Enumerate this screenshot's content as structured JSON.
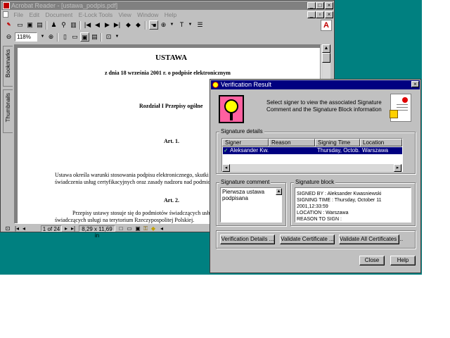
{
  "acrobat": {
    "title": "Acrobat Reader - [ustawa_podpis.pdf]",
    "menu": [
      "File",
      "Edit",
      "Document",
      "E-Lock Tools",
      "View",
      "Window",
      "Help"
    ],
    "zoom": "118%",
    "side_tabs": {
      "bookmarks": "Bookmarks",
      "thumbnails": "Thumbnails"
    },
    "status": {
      "page": "1 of 24",
      "size": "8,29 x 11,69 in"
    }
  },
  "document": {
    "heading": "USTAWA",
    "subheading": "z dnia 18 września 2001 r.  o podpisie elektronicznym",
    "chapter": "Rozdział I  Przepisy ogólne",
    "art1": "Art. 1.",
    "para1_line1": "Ustawa określa warunki stosowania podpisu elektronicznego, skutki",
    "para1_line2": "świadczenia usług certyfikacyjnych oraz zasady nadzoru nad podmio",
    "art2": "Art. 2.",
    "para2_line1": "Przepisy ustawy stosuje się do podmiotów świadczących usługi certy",
    "para2_line2": "świadczących usługi na terytorium Rzeczypospolitej Polskiej."
  },
  "dialog": {
    "title": "Verification Result",
    "instruction": "Select signer to view the associated Signature Comment and the Signature Block information",
    "details_label": "Signature details",
    "columns": [
      "Signer",
      "Reason",
      "Signing Time",
      "Location"
    ],
    "row": {
      "signer": "Aleksander Kw...",
      "reason": "",
      "time": "Thursday, Octob...",
      "location": "Warszawa"
    },
    "comment_label": "Signature comment",
    "comment_text": "Pierwsza ustawa podpisana",
    "block_label": "Signature block",
    "block_lines": [
      "SIGNED BY : Aleksander Kwasniewski",
      "SIGNING TIME : Thursday, October 11 2001,12:33:59",
      "LOCATION : Warszawa",
      "REASON TO SIGN :"
    ],
    "buttons": {
      "details": "Verification Details ...",
      "validate": "Validate Certificate ...",
      "validate_all": "Validate All Certificates ...",
      "close": "Close",
      "help": "Help"
    }
  }
}
